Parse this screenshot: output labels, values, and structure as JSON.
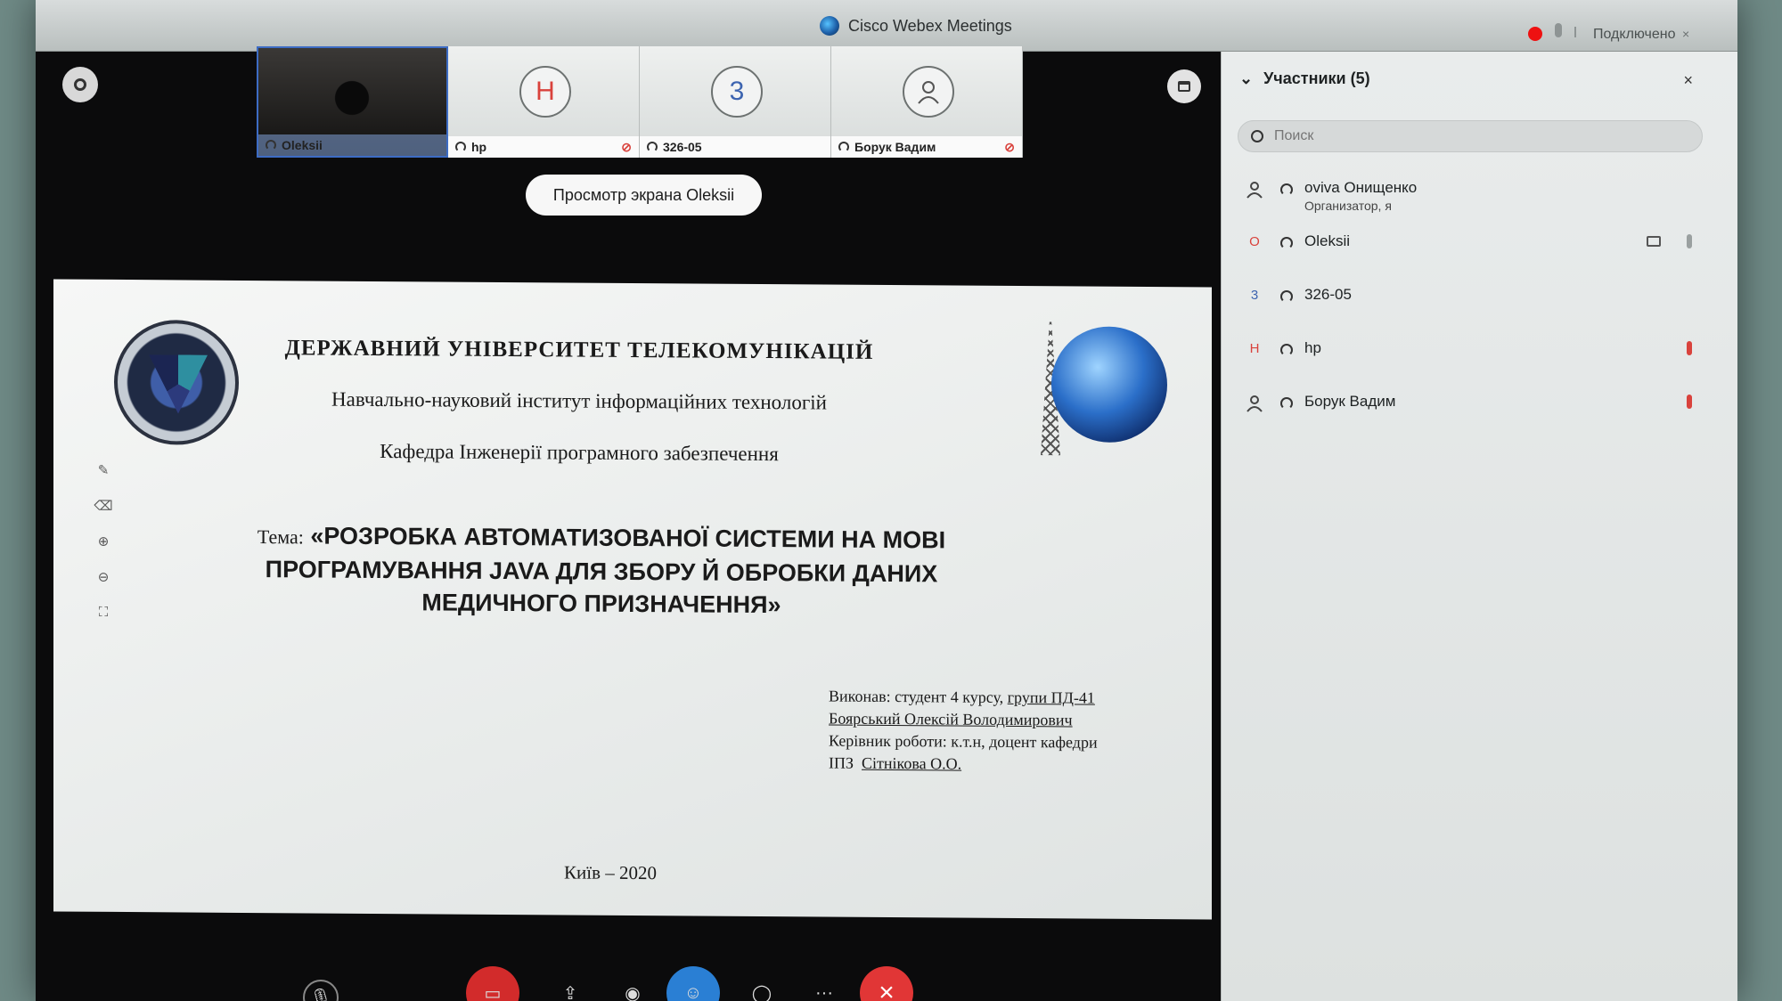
{
  "window": {
    "title": "Cisco Webex Meetings",
    "status": "Подключено",
    "close_label": "×",
    "icons": [
      "webex-logo",
      "record-dot",
      "mic-icon"
    ]
  },
  "thumbnails": [
    {
      "name": "Oleksii",
      "type": "video",
      "muted": false
    },
    {
      "name": "hp",
      "initial": "H",
      "type": "avatar",
      "muted": true
    },
    {
      "name": "326-05",
      "initial": "3",
      "type": "avatar",
      "muted": false
    },
    {
      "name": "Борук Вадим",
      "initial": "",
      "type": "person-icon",
      "muted": true
    }
  ],
  "view_screen_button": "Просмотр экрана Oleksii",
  "slide": {
    "university": "ДЕРЖАВНИЙ УНІВЕРСИТЕТ ТЕЛЕКОМУНІКАЦІЙ",
    "institute": "Навчально-науковий інститут інформаційних технологій",
    "department": "Кафедра Інженерії програмного забезпечення",
    "topic_label": "Тема:",
    "topic": "«РОЗРОБКА АВТОМАТИЗОВАНОЇ СИСТЕМИ НА МОВІ ПРОГРАМУВАННЯ JAVA ДЛЯ ЗБОРУ Й ОБРОБКИ ДАНИХ МЕДИЧНОГО ПРИЗНАЧЕННЯ»",
    "performer_line1": "Виконав: студент 4 курсу,",
    "performer_group": "групи ПД-41",
    "performer_name": "Боярський Олексій Володимирович",
    "supervisor_line": "Керівник роботи: к.т.н, доцент кафедри",
    "supervisor_prefix": "ІПЗ",
    "supervisor_name": "Сітнікова О.О.",
    "city_year": "Київ – 2020"
  },
  "panel": {
    "title": "Участники (5)",
    "close_label": "×",
    "search_placeholder": "Поиск",
    "participants": [
      {
        "name": "oviva Онищенко",
        "role": "Организатор, я",
        "avatar": "person-icon",
        "muted": false
      },
      {
        "name": "Oleksii",
        "role": "",
        "avatar": "O",
        "muted": false,
        "camera": true
      },
      {
        "name": "326-05",
        "role": "",
        "avatar": "3",
        "muted": false
      },
      {
        "name": "hp",
        "role": "",
        "avatar": "H",
        "muted": true
      },
      {
        "name": "Борук Вадим",
        "role": "",
        "avatar": "person-icon",
        "muted": true
      }
    ]
  },
  "controls": {
    "more_label": "···",
    "leave_label": "×"
  }
}
